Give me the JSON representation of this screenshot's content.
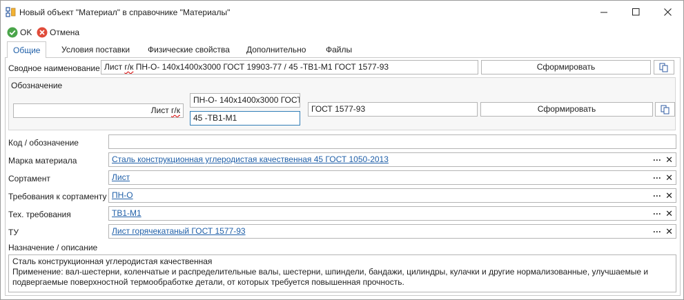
{
  "window": {
    "title": "Новый объект \"Материал\" в справочнике \"Материалы\""
  },
  "toolbar": {
    "ok_label": "OK",
    "cancel_label": "Отмена"
  },
  "tabs": [
    {
      "label": "Общие",
      "active": true
    },
    {
      "label": "Условия поставки",
      "active": false
    },
    {
      "label": "Физические свойства",
      "active": false
    },
    {
      "label": "Дополнительно",
      "active": false
    },
    {
      "label": "Файлы",
      "active": false
    }
  ],
  "summary": {
    "label": "Сводное наименование",
    "value_prefix": "Лист ",
    "value_spell": "г/к",
    "value_rest": " ПН-О- 140x1400x3000 ГОСТ 19903-77 / 45 -ТВ1-М1 ГОСТ 1577-93",
    "generate_label": "Сформировать"
  },
  "designation": {
    "group_label": "Обозначение",
    "left_prefix": "Лист ",
    "left_spell": "г/к",
    "top_value": "ПН-О- 140x1400x3000 ГОСТ",
    "bottom_value": "45 -ТВ1-М1",
    "gost_value": "ГОСТ 1577-93",
    "generate_label": "Сформировать"
  },
  "fields": {
    "code_label": "Код / обозначение",
    "code_value": "",
    "grade_label": "Марка материала",
    "grade_value": "Сталь конструкционная углеродистая качественная 45 ГОСТ 1050-2013",
    "assortment_label": "Сортамент",
    "assortment_value": "Лист",
    "assortment_req_label": "Требования к сортаменту",
    "assortment_req_value": "ПН-О",
    "tech_req_label": "Тех. требования",
    "tech_req_value": "ТВ1-М1",
    "tu_label": "ТУ",
    "tu_value": "Лист горячекатаный ГОСТ 1577-93",
    "more_glyph": "···",
    "clear_glyph": "✕"
  },
  "description": {
    "label": "Назначение / описание",
    "line1": "Сталь конструкционная углеродистая качественная",
    "line2": "Применение: вал-шестерни, коленчатые и распределительные валы, шестерни, шпиндели, бандажи, цилиндры, кулачки и другие нормализованные, улучшаемые и",
    "line3": "подвергаемые поверхностной термообработке детали, от которых требуется повышенная прочность."
  },
  "colors": {
    "accent": "#1f5fa8",
    "ok_green": "#4aa54a",
    "cancel_red": "#e04b3a",
    "focus_border": "#2f7db6"
  }
}
